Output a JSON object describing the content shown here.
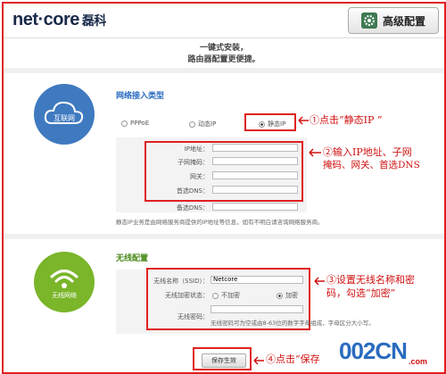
{
  "header": {
    "logo_text": "net·core",
    "logo_cn": "磊科",
    "advanced_button": "高级配置"
  },
  "tagline": {
    "line1": "一键式安装，",
    "line2": "路由器配置更便捷。"
  },
  "network": {
    "icon_label": "互联网",
    "title": "网络接入类型",
    "options": [
      "PPPoE",
      "动态IP",
      "静态IP"
    ],
    "selected": "静态IP",
    "fields": {
      "ip": "IP地址：",
      "mask": "子网掩码：",
      "gateway": "网关：",
      "dns1": "首选DNS：",
      "dns2": "备选DNS："
    },
    "note": "静态IP业务是由网络服务商提供的IP地址等信息，如有不明白请咨询网络服务商。"
  },
  "wireless": {
    "icon_label": "无线网络",
    "title": "无线配置",
    "ssid_label": "无线名称（SSID）：",
    "ssid_value": "Netcore",
    "encrypt_label": "无线加密状态：",
    "encrypt_options": [
      "不加密",
      "加密"
    ],
    "encrypt_selected": "加密",
    "password_label": "无线密码：",
    "password_note": "无线密码可为空或由8-63位的数字字母组成，字母区分大小写。"
  },
  "save_button": "保存生效",
  "annotations": {
    "a1": "①点击“静态IP ”",
    "a2_line1": "②输入IP地址、子网",
    "a2_line2": "掩码、网关、首选DNS",
    "a3_line1": "③设置无线名称和密",
    "a3_line2": "码，勾选“加密”",
    "a4": "④点击“保存"
  },
  "watermark": {
    "text1": "002CN",
    "text2": ".com"
  },
  "colors": {
    "accent_blue": "#2a6bbf",
    "cloud_blue": "#3f7ac0",
    "wifi_green": "#7ab52a",
    "annotation_red": "#d01010"
  }
}
